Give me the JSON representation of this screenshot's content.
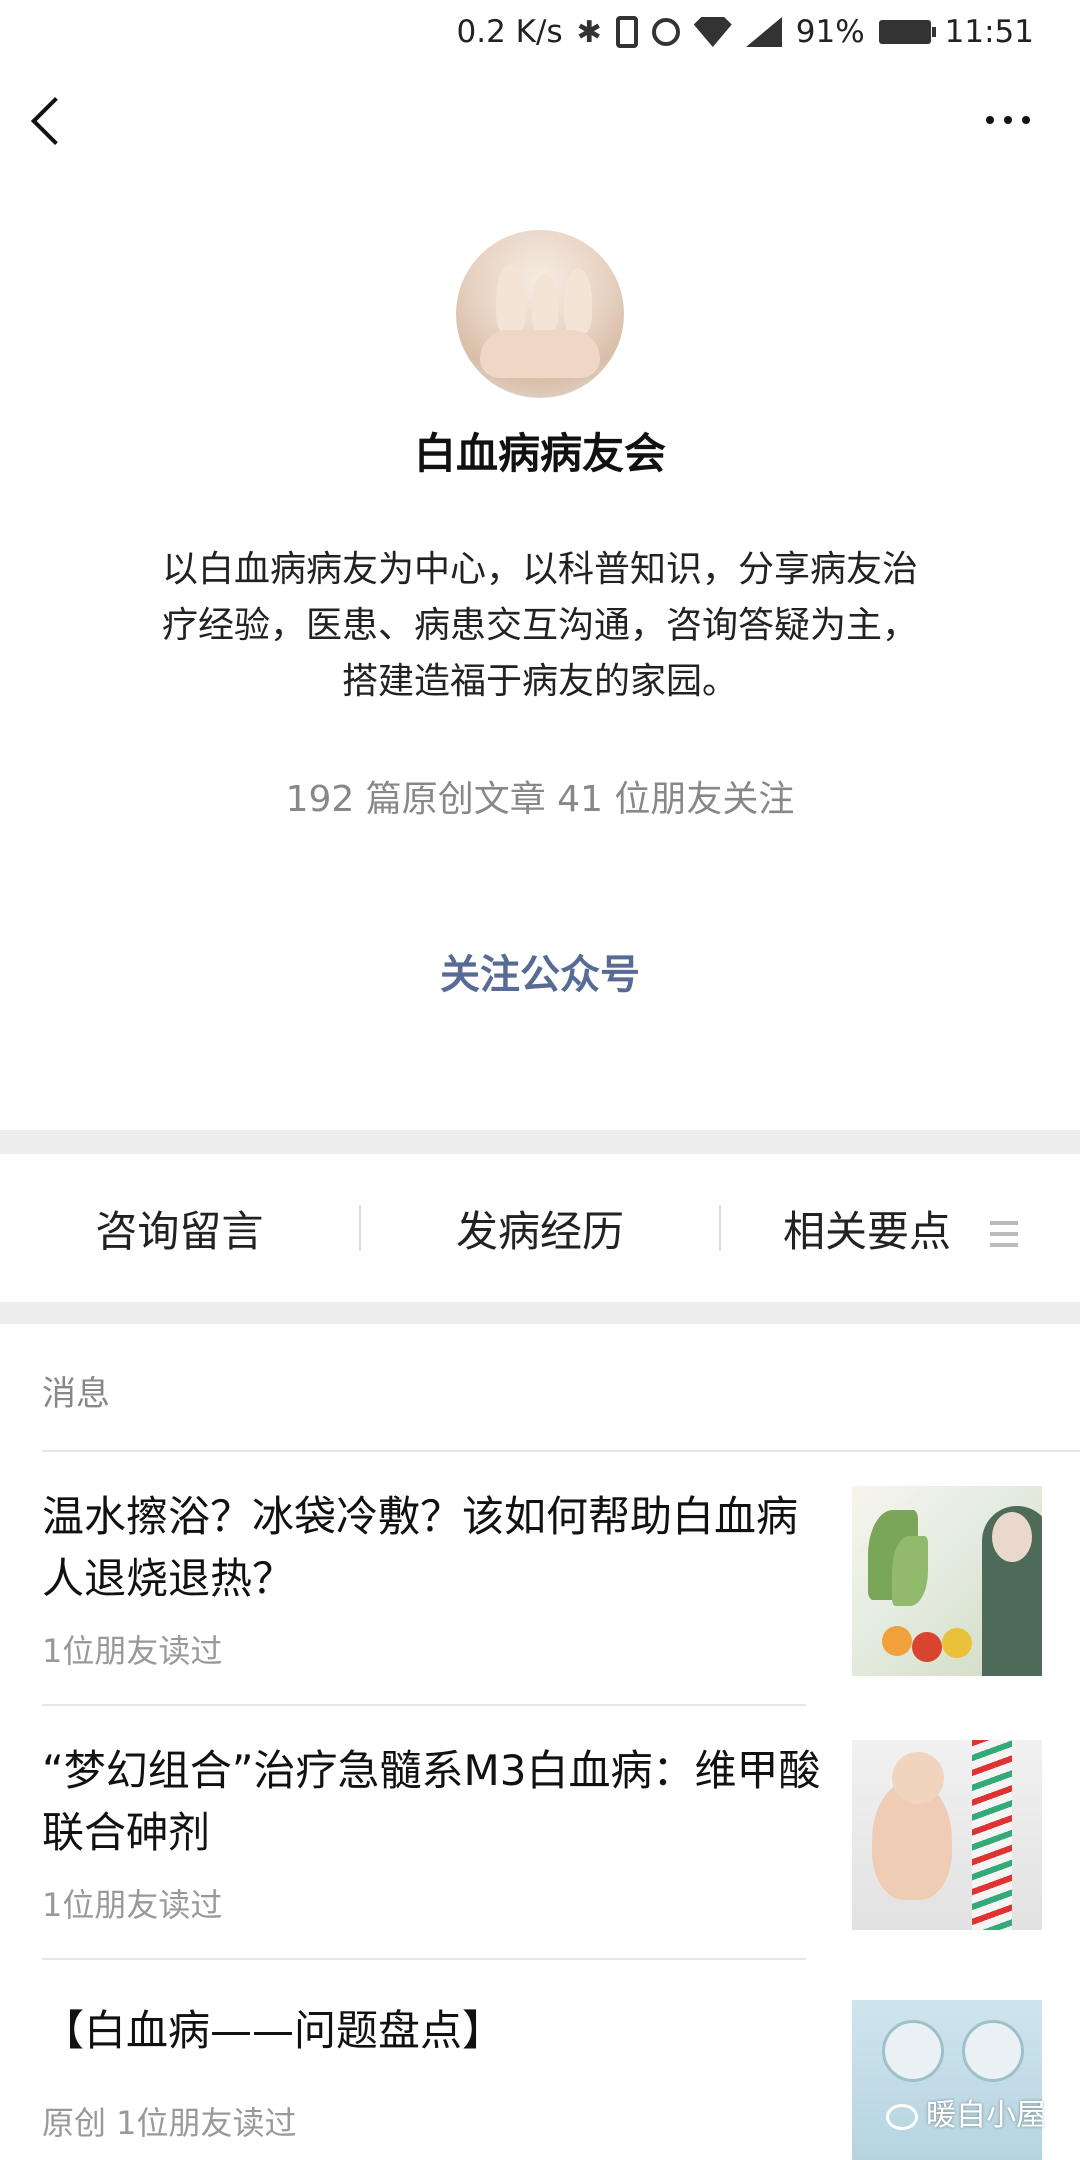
{
  "status_bar": {
    "speed": "0.2 K/s",
    "battery": "91%",
    "time": "11:51"
  },
  "profile": {
    "name": "白血病病友会",
    "intro_lines": [
      "以白血病病友为中心，以科普知识，分享病友治",
      "疗经验，医患、病患交互沟通，咨询答疑为主，",
      "搭建造福于病友的家园。"
    ],
    "stats": "192 篇原创文章  41 位朋友关注",
    "follow_label": "关注公众号"
  },
  "menu": {
    "items": [
      "咨询留言",
      "发病经历",
      "相关要点"
    ]
  },
  "messages": {
    "section_label": "消息",
    "articles": [
      {
        "title": "温水擦浴？冰袋冷敷？该如何帮助白血病人退烧退热？",
        "meta": "1位朋友读过"
      },
      {
        "title": "“梦幻组合”治疗急髓系M3白血病：维甲酸联合砷剂",
        "meta": "1位朋友读过"
      },
      {
        "title": "【白血病——问题盘点】",
        "meta": "原创 1位朋友读过"
      }
    ]
  },
  "watermark": "暖自小屋",
  "icons": {
    "back": "back-arrow-icon",
    "more": "more-dots-icon",
    "menu": "menu-lines-icon"
  },
  "colors": {
    "link": "#576b95",
    "meta": "#999999"
  }
}
